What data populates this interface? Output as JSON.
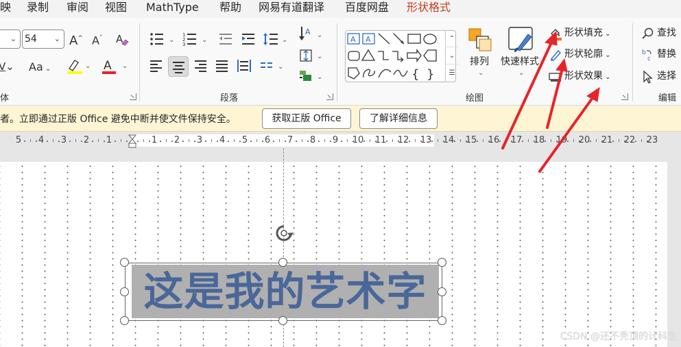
{
  "tabs": [
    "映",
    "录制",
    "审阅",
    "视图",
    "MathType",
    "帮助",
    "网易有道翻译",
    "百度网盘",
    "形状格式"
  ],
  "font": {
    "name_value": "",
    "size_value": "54",
    "grow_label": "A",
    "shrink_label": "A",
    "case_label": "Aa",
    "group_label": "体"
  },
  "paragraph": {
    "group_label": "段落"
  },
  "drawing": {
    "group_label": "绘图",
    "arrange_label": "排列",
    "quick_styles_label": "快速样式",
    "shape_fill_label": "形状填充",
    "shape_outline_label": "形状轮廓",
    "shape_effects_label": "形状效果"
  },
  "editing": {
    "group_label": "编辑",
    "find_label": "查找",
    "replace_label": "替换",
    "select_label": "选择"
  },
  "message_bar": {
    "text": "者。立即通过正版 Office 避免中断并使文件保持安全。",
    "get_genuine_label": "获取正版 Office",
    "learn_more_label": "了解详细信息"
  },
  "ruler": {
    "numbers": [
      "5",
      "4",
      "3",
      "2",
      "1",
      "",
      "1",
      "2",
      "3",
      "4",
      "5",
      "6",
      "7",
      "8",
      "9",
      "10",
      "11",
      "12",
      "13",
      "14",
      "15",
      "16",
      "17",
      "18",
      "19",
      "20",
      "21",
      "22",
      "23"
    ]
  },
  "slide": {
    "wordart_text": "这是我的艺术字"
  },
  "watermark": "CSDN @还不秃顶的计科生",
  "colors": {
    "active_tab": "#c43e1c",
    "arrow": "#e8232a",
    "wordart": "#4a6799",
    "highlight": "#ffff00",
    "font_color": "#e8232a",
    "fill_bar": "#f0701d"
  }
}
